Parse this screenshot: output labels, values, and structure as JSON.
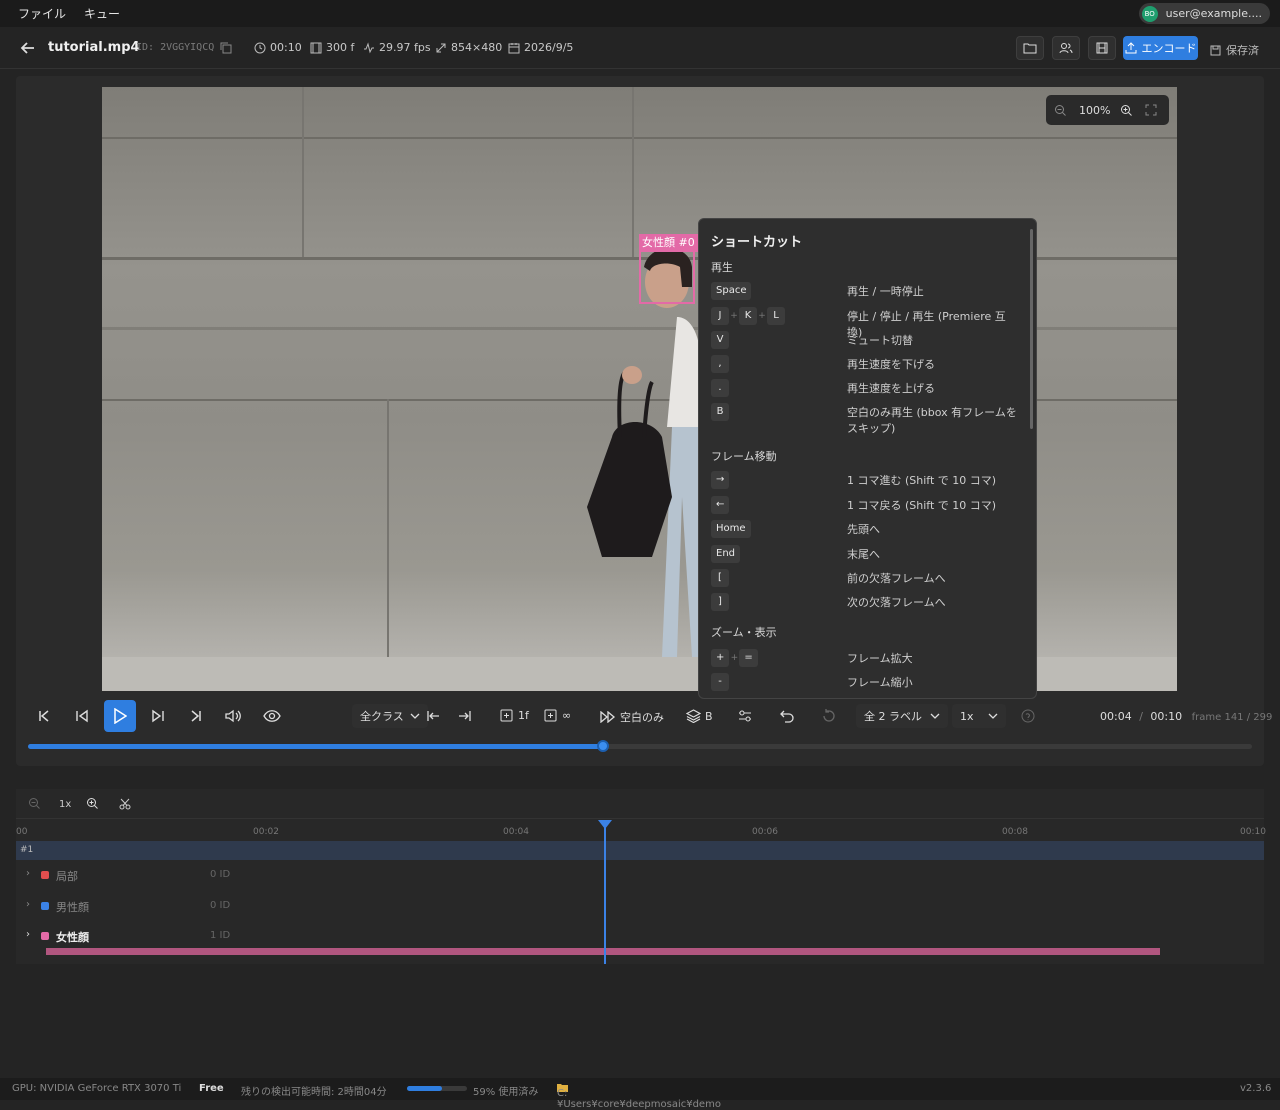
{
  "menu": {
    "file": "ファイル",
    "queue": "キュー"
  },
  "user": {
    "initials": "BO",
    "email": "user@example...."
  },
  "header": {
    "filename": "tutorial.mp4",
    "id_label": "ID:",
    "id_value": "2VGGYIQCQ",
    "duration": "00:10",
    "frames": "300 f",
    "fps": "29.97 fps",
    "resolution": "854×480",
    "date": "2026/9/5",
    "encode_label": "エンコード",
    "saved_label": "保存済"
  },
  "viewer": {
    "zoom": "100%",
    "bbox_label": "女性顔 #0",
    "bbox_color": "#e36aa7"
  },
  "shortcuts": {
    "title": "ショートカット",
    "sections": [
      {
        "label": "再生",
        "rows": [
          {
            "keys": [
              "Space"
            ],
            "desc": "再生 / 一時停止"
          },
          {
            "keys": [
              "J",
              "K",
              "L"
            ],
            "desc": "停止 / 停止 / 再生 (Premiere 互換)"
          },
          {
            "keys": [
              "V"
            ],
            "desc": "ミュート切替"
          },
          {
            "keys": [
              ","
            ],
            "desc": "再生速度を下げる"
          },
          {
            "keys": [
              "."
            ],
            "desc": "再生速度を上げる"
          },
          {
            "keys": [
              "B"
            ],
            "desc": "空白のみ再生 (bbox 有フレームをスキップ)"
          }
        ]
      },
      {
        "label": "フレーム移動",
        "rows": [
          {
            "keys": [
              "→"
            ],
            "desc": "1 コマ進む (Shift で 10 コマ)"
          },
          {
            "keys": [
              "←"
            ],
            "desc": "1 コマ戻る (Shift で 10 コマ)"
          },
          {
            "keys": [
              "Home"
            ],
            "desc": "先頭へ"
          },
          {
            "keys": [
              "End"
            ],
            "desc": "末尾へ"
          },
          {
            "keys": [
              "["
            ],
            "desc": "前の欠落フレームへ"
          },
          {
            "keys": [
              "]"
            ],
            "desc": "次の欠落フレームへ"
          }
        ]
      },
      {
        "label": "ズーム・表示",
        "rows": [
          {
            "keys": [
              "+",
              "="
            ],
            "desc": "フレーム拡大"
          },
          {
            "keys": [
              "-"
            ],
            "desc": "フレーム縮小"
          }
        ]
      }
    ]
  },
  "controls": {
    "class_select": "全クラス",
    "step_1f": "1f",
    "step_inf": "∞",
    "blank_only": "空白のみ",
    "layer_b": "B",
    "labels_select": "全 2 ラベル",
    "speed_select": "1x",
    "current_time": "00:04",
    "separator": "/",
    "total_time": "00:10",
    "frame_info": "frame 141 / 299",
    "progress": 0.47
  },
  "timeline": {
    "zoom_label": "1x",
    "ticks": [
      "00",
      "00:02",
      "00:04",
      "00:06",
      "00:08",
      "00:10"
    ],
    "track_id": "#1",
    "tracks": [
      {
        "name": "局部",
        "count": "0 ID",
        "color": "#e04e4e"
      },
      {
        "name": "男性顔",
        "count": "0 ID",
        "color": "#3b82e6"
      },
      {
        "name": "女性顔",
        "count": "1 ID",
        "color": "#e36aa7"
      }
    ],
    "segment_color": "#b1567f"
  },
  "status": {
    "gpu": "GPU: NVIDIA GeForce RTX 3070 Ti",
    "plan": "Free",
    "remaining": "残りの検出可能時間: 2時間04分",
    "usage_text": "59% 使用済み",
    "usage": 0.59,
    "path": "C:¥Users¥core¥deepmosaic¥demo",
    "version": "v2.3.6"
  }
}
